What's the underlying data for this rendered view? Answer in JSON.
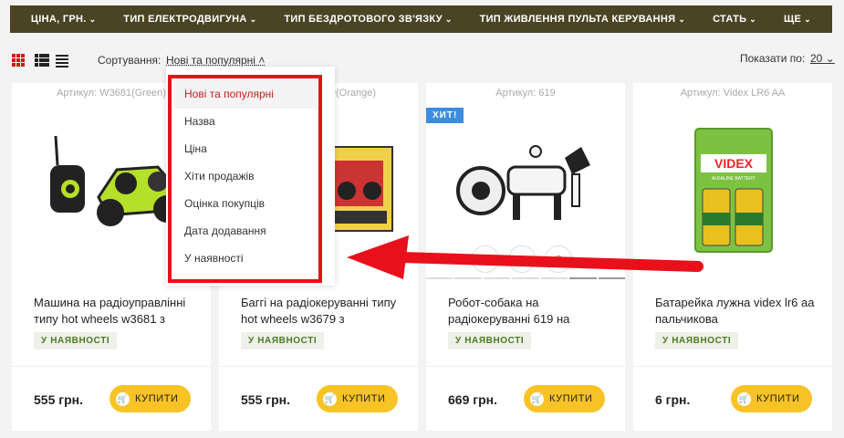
{
  "nav": [
    {
      "label": "ЦІНА, ГРН."
    },
    {
      "label": "ТИП ЕЛЕКТРОДВИГУНА"
    },
    {
      "label": "ТИП БЕЗДРОТОВОГО ЗВ'ЯЗКУ"
    },
    {
      "label": "ТИП ЖИВЛЕННЯ ПУЛЬТА КЕРУВАННЯ"
    },
    {
      "label": "СТАТЬ"
    },
    {
      "label": "ЩЕ"
    }
  ],
  "toolbar": {
    "sort_label": "Сортування:",
    "sort_value": "Нові та популярні",
    "show_label": "Показати по:",
    "show_value": "20"
  },
  "sort_options": [
    {
      "label": "Нові та популярні",
      "active": true
    },
    {
      "label": "Назва"
    },
    {
      "label": "Ціна"
    },
    {
      "label": "Хіти продажів"
    },
    {
      "label": "Оцінка покупців"
    },
    {
      "label": "Дата додавання"
    },
    {
      "label": "У наявності"
    }
  ],
  "products": [
    {
      "sku": "Артикул: W3681(Green)",
      "title": "Машина на радіоуправлінні типу hot wheels w3681 з",
      "stock": "У НАЯВНОСТІ",
      "price": "555 грн.",
      "buy": "КУПИТИ"
    },
    {
      "sku": "Артикул: W3679(Orange)",
      "title": "Баггі на радіокеруванні типу hot wheels w3679 з",
      "stock": "У НАЯВНОСТІ",
      "price": "555 грн.",
      "buy": "КУПИТИ"
    },
    {
      "sku": "Артикул: 619",
      "badge": "ХИТ!",
      "title": "Робот-собака на радіокеруванні 619 на",
      "stock": "У НАЯВНОСТІ",
      "price": "669 грн.",
      "buy": "КУПИТИ"
    },
    {
      "sku": "Артикул: Videx LR6 AA",
      "title": "Батарейка лужна videx lr6 aa пальчикова",
      "stock": "У НАЯВНОСТІ",
      "price": "6 грн.",
      "buy": "КУПИТИ"
    }
  ],
  "images": {
    "battery_brand": "VIDEX",
    "battery_sub": "ALKALINE BATTERY"
  },
  "colors": {
    "nav_bg": "#4a4424",
    "accent_red": "#e8101a",
    "buy_yellow": "#f7c325",
    "badge_blue": "#3d8ce0",
    "stock_green": "#4d7a1f"
  }
}
